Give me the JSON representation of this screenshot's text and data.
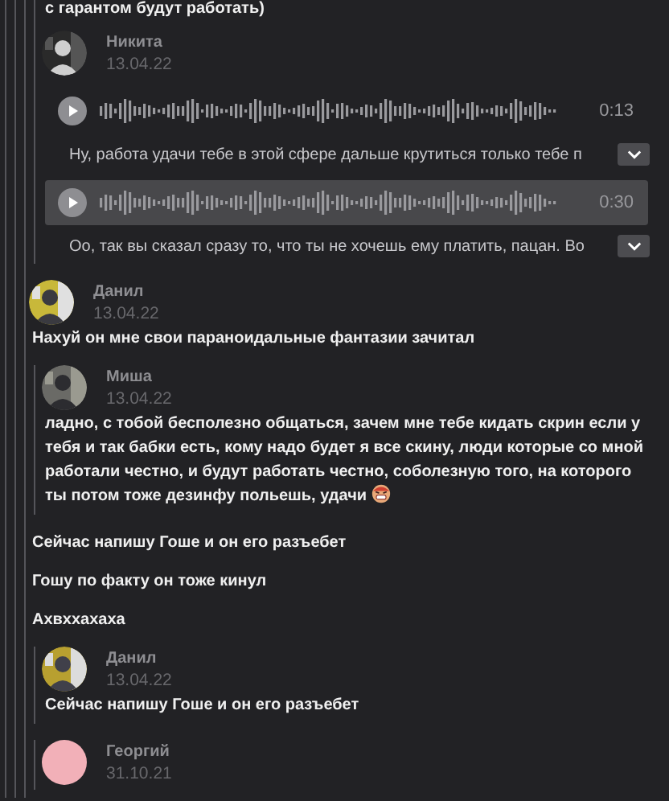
{
  "items": [
    {
      "kind": "quote",
      "parts": [
        {
          "kind": "text",
          "text": "с гарантом будут работать)"
        },
        {
          "kind": "header",
          "author": "Никита",
          "date": "13.04.22"
        },
        {
          "kind": "voice",
          "duration": "0:13",
          "transcript": "Ну, работа удачи тебе в этой сфере дальше крутиться только тебе п",
          "selected": false
        },
        {
          "kind": "voice",
          "duration": "0:30",
          "transcript": "Оо, так вы сказал сразу то, что ты не хочешь ему платить, пацан. Во",
          "selected": true
        }
      ]
    },
    {
      "kind": "header",
      "author": "Данил",
      "date": "13.04.22"
    },
    {
      "kind": "text",
      "text": "Нахуй он мне свои параноидальные фантазии зачитал"
    },
    {
      "kind": "quote",
      "parts": [
        {
          "kind": "header",
          "author": "Миша",
          "date": "13.04.22"
        },
        {
          "kind": "text",
          "text": "ладно, с тобой бесполезно общаться, зачем мне тебе кидать скрин если у тебя и так бабки есть, кому надо будет я все скину, люди которые со мной работали честно, и будут работать честно, соболезную того, на которого ты потом тоже дезинфу польешь, удачи",
          "emoji": true
        }
      ]
    },
    {
      "kind": "text",
      "text": "Сейчас напишу Гоше и он его разъебет"
    },
    {
      "kind": "text",
      "text": "Гошу по факту он тоже кинул"
    },
    {
      "kind": "text",
      "text": "Ахвххахаха"
    },
    {
      "kind": "quote",
      "parts": [
        {
          "kind": "header",
          "author": "Данил",
          "date": "13.04.22"
        },
        {
          "kind": "text",
          "text": "Сейчас напишу Гоше и он его разъебет"
        }
      ]
    },
    {
      "kind": "quote",
      "parts": [
        {
          "kind": "header",
          "avatar": {
            "kind": "plain"
          },
          "author": "Георгий",
          "date": "31.10.21"
        }
      ]
    }
  ]
}
